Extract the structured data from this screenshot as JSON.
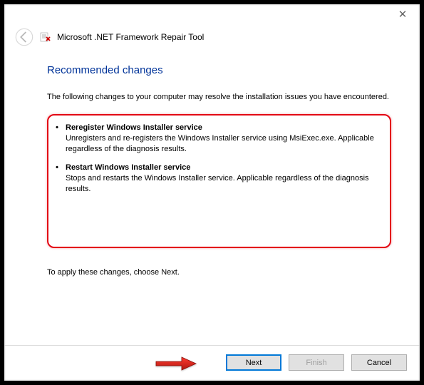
{
  "window": {
    "title": "Microsoft .NET Framework Repair Tool"
  },
  "page": {
    "heading": "Recommended changes",
    "intro": "The following changes to your computer may resolve the installation issues you have encountered.",
    "apply_note": "To apply these changes, choose Next."
  },
  "changes": [
    {
      "title": "Reregister Windows Installer service",
      "description": "Unregisters and re-registers the Windows Installer service using MsiExec.exe. Applicable regardless of the diagnosis results."
    },
    {
      "title": "Restart Windows Installer service",
      "description": "Stops and restarts the Windows Installer service. Applicable regardless of the diagnosis results."
    }
  ],
  "buttons": {
    "next": "Next",
    "finish": "Finish",
    "cancel": "Cancel"
  }
}
